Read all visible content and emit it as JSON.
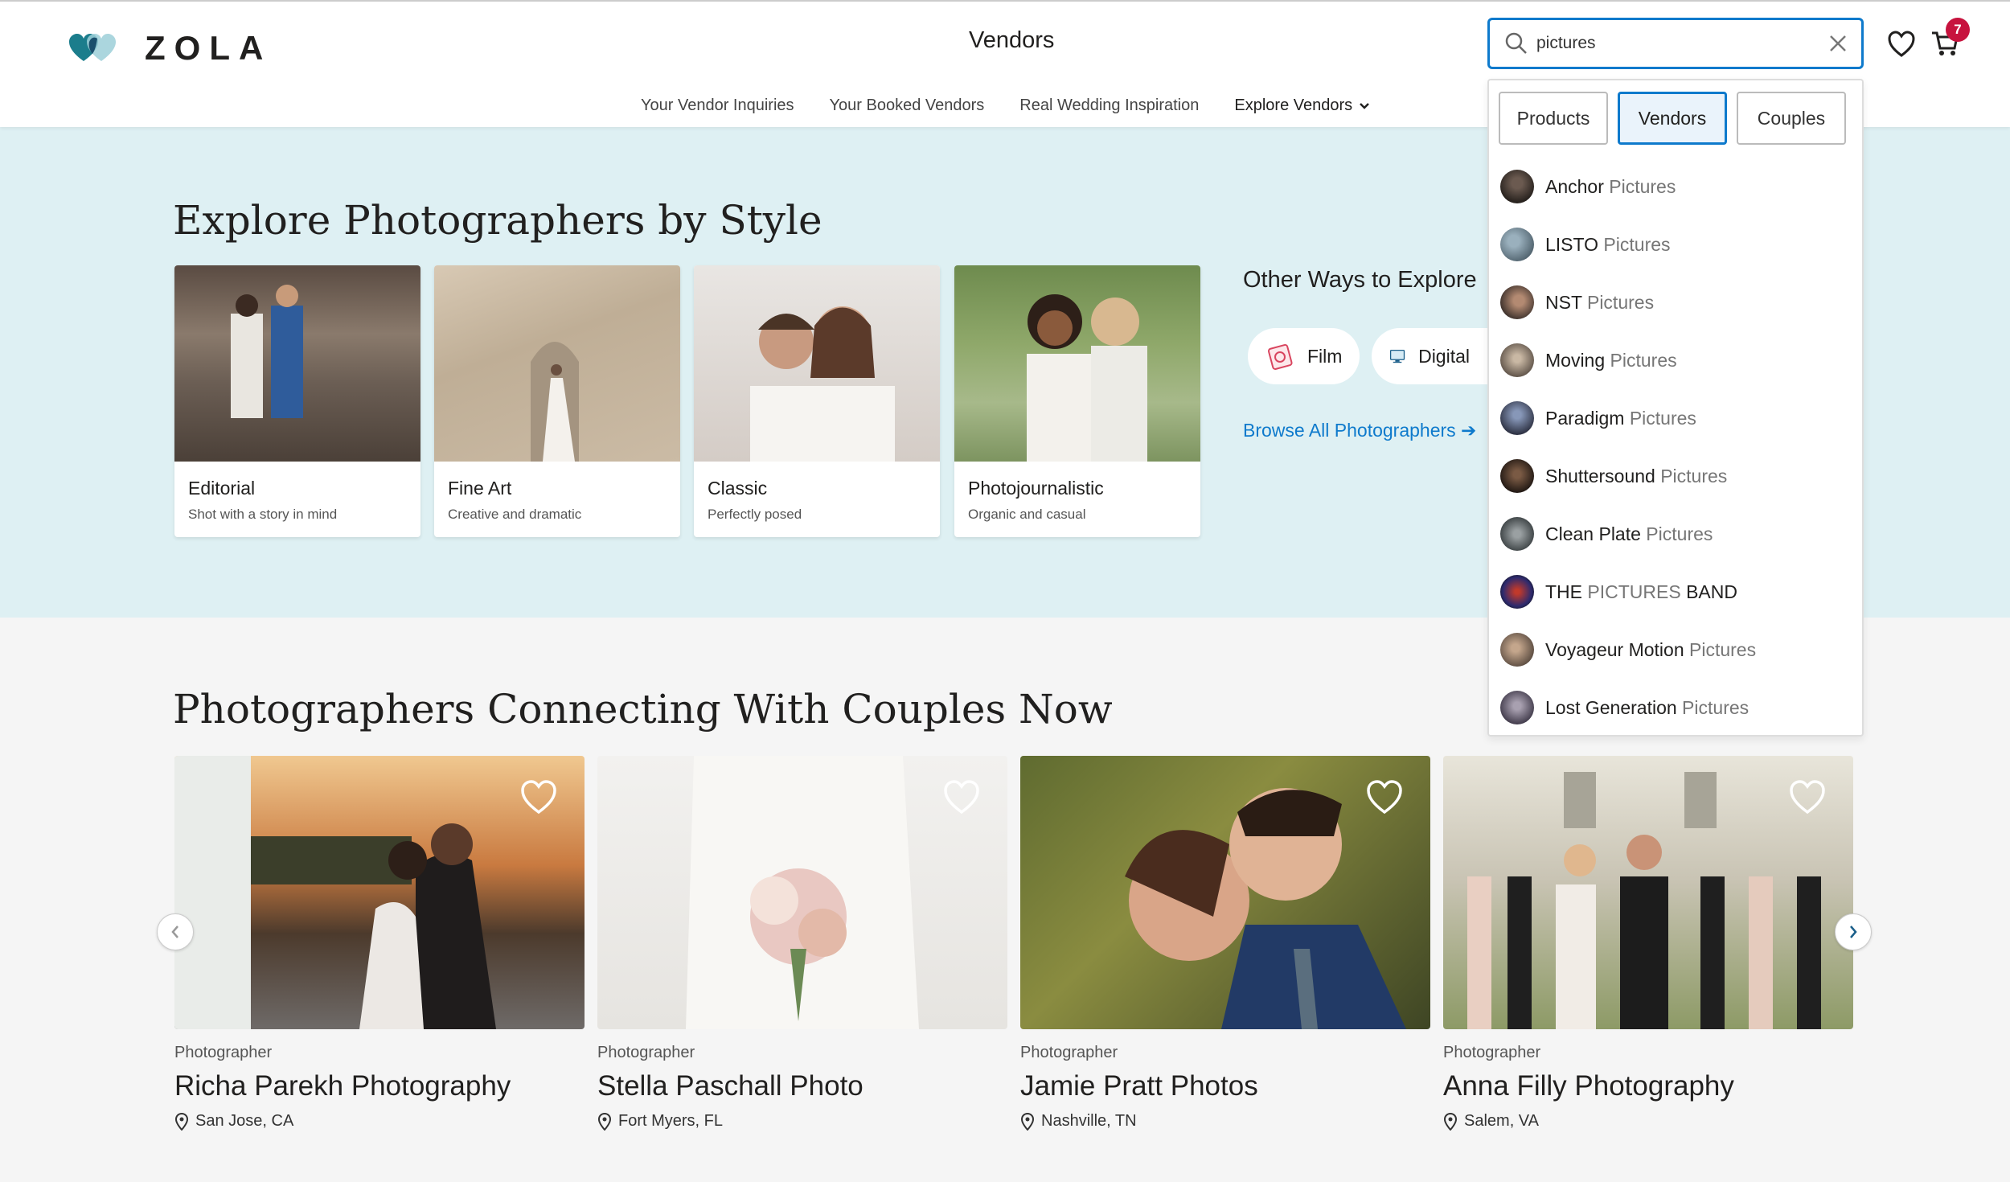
{
  "header": {
    "logo_text": "ZOLA",
    "title": "Vendors",
    "subnav": [
      "Your Vendor Inquiries",
      "Your Booked Vendors",
      "Real Wedding Inspiration"
    ],
    "explore_label": "Explore Vendors",
    "cart_count": "7"
  },
  "search": {
    "value": "pictures",
    "tabs": [
      "Products",
      "Vendors",
      "Couples"
    ],
    "active_tab": "Vendors",
    "results": [
      {
        "name": "Anchor",
        "match": " Pictures"
      },
      {
        "name": "LISTO",
        "match": " Pictures"
      },
      {
        "name": "NST",
        "match": " Pictures"
      },
      {
        "name": "Moving",
        "match": " Pictures"
      },
      {
        "name": "Paradigm",
        "match": " Pictures"
      },
      {
        "name": "Shuttersound",
        "match": " Pictures"
      },
      {
        "name": "Clean Plate",
        "match": " Pictures"
      },
      {
        "name": "THE ",
        "match": "PICTURES",
        "suffix": " BAND"
      },
      {
        "name": "Voyageur Motion",
        "match": " Pictures"
      },
      {
        "name": "Lost Generation",
        "match": " Pictures"
      }
    ]
  },
  "hero": {
    "title": "Explore Photographers by Style",
    "styles": [
      {
        "name": "Editorial",
        "desc": "Shot with a story in mind"
      },
      {
        "name": "Fine Art",
        "desc": "Creative and dramatic"
      },
      {
        "name": "Classic",
        "desc": "Perfectly posed"
      },
      {
        "name": "Photojournalistic",
        "desc": "Organic and casual"
      }
    ],
    "other_title": "Other Ways to Explore",
    "pills": [
      "Film",
      "Digital"
    ],
    "browse_label": "Browse All Photographers"
  },
  "lower": {
    "title": "Photographers Connecting With Couples Now",
    "vendors": [
      {
        "category": "Photographer",
        "name": "Richa Parekh Photography",
        "location": "San Jose, CA"
      },
      {
        "category": "Photographer",
        "name": "Stella Paschall Photo",
        "location": "Fort Myers, FL"
      },
      {
        "category": "Photographer",
        "name": "Jamie Pratt Photos",
        "location": "Nashville, TN"
      },
      {
        "category": "Photographer",
        "name": "Anna Filly Photography",
        "location": "Salem, VA"
      }
    ]
  },
  "colors": {
    "accent": "#0e7acc",
    "badge": "#c7133e",
    "hero_bg": "#def0f3"
  }
}
